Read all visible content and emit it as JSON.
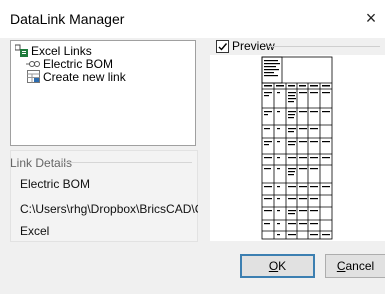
{
  "window": {
    "title": "DataLink Manager",
    "close_glyph": "×"
  },
  "tree": {
    "root": {
      "label": "Excel Links",
      "icon": "excel-links-icon"
    },
    "items": [
      {
        "label": "Electric BOM",
        "icon": "datalink-icon"
      },
      {
        "label": "Create new link",
        "icon": "new-link-icon"
      }
    ]
  },
  "link_details": {
    "heading": "Link Details",
    "name": "Electric BOM",
    "path": "C:\\Users\\rhg\\Dropbox\\BricsCAD\\CD - :",
    "type": "Excel"
  },
  "preview": {
    "label": "Preview",
    "checked": true
  },
  "buttons": {
    "ok": {
      "accel": "O",
      "rest": "K"
    },
    "cancel": {
      "accel": "C",
      "rest": "ancel"
    }
  },
  "colors": {
    "ok_border": "#3c7fb1",
    "excel_green": "#1e7b3c"
  }
}
